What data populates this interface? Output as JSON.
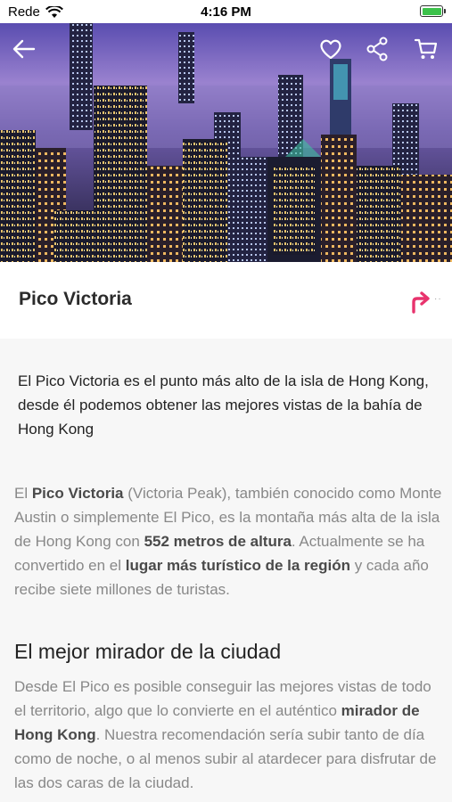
{
  "status": {
    "carrier": "Rede",
    "time": "4:16 PM"
  },
  "header": {
    "back_icon": "arrow-left-icon",
    "favorite_icon": "heart-icon",
    "share_icon": "share-icon",
    "cart_icon": "cart-icon"
  },
  "place": {
    "title": "Pico Victoria",
    "directions_icon": "turn-right-arrow-icon",
    "accent_color": "#e8336d"
  },
  "intro": "El Pico Victoria es el punto más alto de la isla de Hong Kong, desde él podemos obtener las mejores vistas de la bahía de Hong Kong",
  "body": {
    "p1_a": "El ",
    "p1_b": "Pico Victoria",
    "p1_c": " (Victoria Peak), también conocido como Monte Austin o simplemente El Pico, es la montaña más alta de la isla de Hong Kong con ",
    "p1_d": "552 metros de altura",
    "p1_e": ". Actualmente se ha convertido en el ",
    "p1_f": "lugar más turístico de la región",
    "p1_g": " y cada año recibe siete millones de turistas.",
    "heading": "El mejor mirador de la ciudad",
    "p2_a": "Desde El Pico es posible conseguir las mejores vistas de todo el territorio, algo que lo convierte en el auténtico ",
    "p2_b": "mirador de Hong Kong",
    "p2_c": ". Nuestra recomendación sería subir tanto de día como de noche, o al menos subir al atardecer para disfrutar de las dos caras de la ciudad."
  }
}
